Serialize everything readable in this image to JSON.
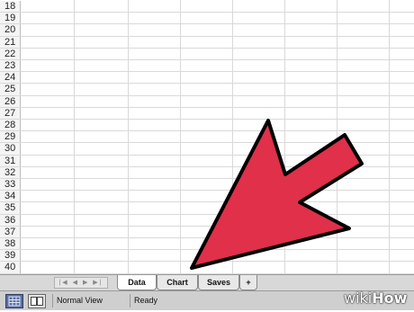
{
  "sheet": {
    "row_numbers": [
      "18",
      "19",
      "20",
      "21",
      "22",
      "23",
      "24",
      "25",
      "26",
      "27",
      "28",
      "29",
      "30",
      "31",
      "32",
      "33",
      "34",
      "35",
      "36",
      "37",
      "38",
      "39",
      "40"
    ]
  },
  "tabs": {
    "items": [
      {
        "label": "Data",
        "active": true
      },
      {
        "label": "Chart",
        "active": false
      },
      {
        "label": "Saves",
        "active": false
      }
    ],
    "add_label": "+",
    "nav_symbols": "|◀ ◀ ▶ ▶|"
  },
  "status": {
    "view_label": "Normal View",
    "ready_label": "Ready"
  },
  "overlay": {
    "arrow_color": "#e0304a",
    "arrow_outline": "#000000",
    "watermark_prefix": "wiki",
    "watermark_suffix": "How"
  }
}
